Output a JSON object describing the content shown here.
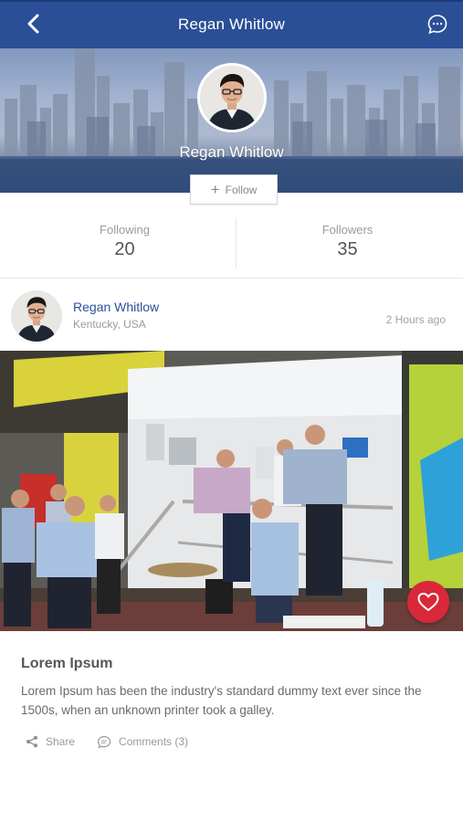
{
  "header": {
    "title": "Regan Whitlow",
    "back_icon": "chevron-left-icon",
    "chat_icon": "chat-bubble-icon"
  },
  "profile": {
    "name": "Regan Whitlow",
    "follow_label": "Follow"
  },
  "stats": {
    "following": {
      "label": "Following",
      "value": "20"
    },
    "followers": {
      "label": "Followers",
      "value": "35"
    }
  },
  "post": {
    "author": "Regan Whitlow",
    "location": "Kentucky, USA",
    "time": "2 Hours ago",
    "title": "Lorem Ipsum",
    "body": "Lorem Ipsum has been the industry's standard dummy text ever since the 1500s, when an unknown printer took a galley.",
    "share_label": "Share",
    "comments_label": "Comments (3)"
  },
  "colors": {
    "brand": "#2b4f97",
    "like": "#d8283a"
  }
}
